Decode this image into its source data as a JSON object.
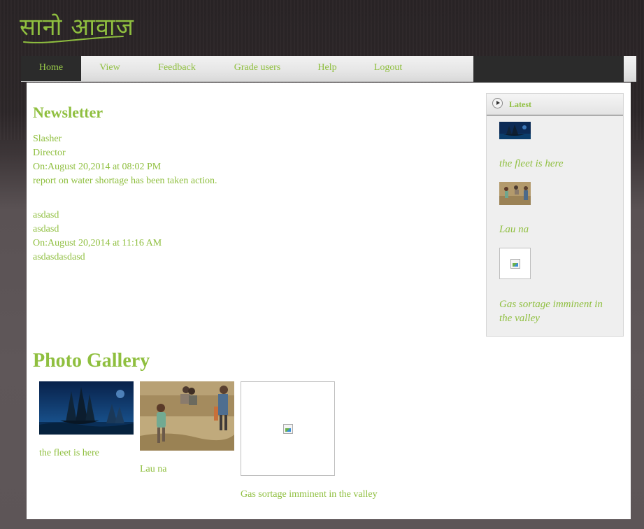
{
  "logo": {
    "text": "सानो आवाज"
  },
  "nav": {
    "items": [
      {
        "label": "Home",
        "active": true
      },
      {
        "label": "View"
      },
      {
        "label": "Feedback"
      },
      {
        "label": "Grade users"
      },
      {
        "label": "Help"
      },
      {
        "label": "Logout"
      }
    ]
  },
  "newsletter": {
    "heading": "Newsletter",
    "posts": [
      {
        "author": "Slasher",
        "role": "Director",
        "date": "On:August 20,2014 at 08:02 PM",
        "body": "report on water shortage has been taken action."
      },
      {
        "author": "asdasd",
        "role": "asdasd",
        "date": "On:August 20,2014 at 11:16 AM",
        "body": "asdasdasdasd"
      }
    ]
  },
  "sidebar": {
    "title": "Latest",
    "items": [
      {
        "caption": "the fleet is here",
        "icon": "ship-thumbnail"
      },
      {
        "caption": "Lau na",
        "icon": "children-thumbnail"
      },
      {
        "caption": "Gas sortage imminent in the valley",
        "icon": "broken-image-icon"
      }
    ]
  },
  "gallery": {
    "heading": "Photo Gallery",
    "items": [
      {
        "caption": "the fleet is here",
        "icon": "ship-photo"
      },
      {
        "caption": "Lau na",
        "icon": "children-photo"
      },
      {
        "caption": "Gas sortage imminent in the valley",
        "icon": "broken-image-icon"
      }
    ]
  },
  "colors": {
    "accent": "#8fbf3f",
    "nav_dark": "#2b2b2b",
    "content_bg": "#ffffff"
  }
}
